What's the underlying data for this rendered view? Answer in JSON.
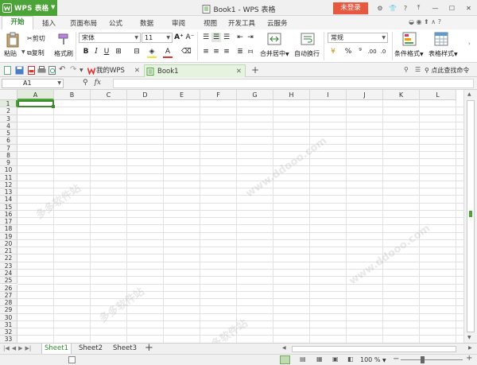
{
  "app": {
    "name": "WPS 表格",
    "window_title": "Book1 - WPS 表格",
    "login_label": "未登录"
  },
  "colors": {
    "brand_green": "#4ca438",
    "login_red": "#e8573f",
    "active_tab_text": "#2f8a2f"
  },
  "ribbon_tabs": [
    "开始",
    "插入",
    "页面布局",
    "公式",
    "数据",
    "审阅",
    "视图",
    "开发工具",
    "云服务"
  ],
  "active_ribbon_tab": "开始",
  "clipboard": {
    "paste": "粘贴",
    "cut": "剪切",
    "copy": "复制",
    "format_painter": "格式刷"
  },
  "font": {
    "name": "宋体",
    "size": "11"
  },
  "alignment": {
    "merge_center": "合并居中",
    "wrap_text": "自动换行"
  },
  "number": {
    "format": "常规"
  },
  "styles": {
    "conditional": "条件格式",
    "table_style": "表格样式"
  },
  "document_tabs": {
    "my_wps": "我的WPS",
    "book": "Book1"
  },
  "command_search": "点此查找命令",
  "formula_bar": {
    "cell_ref": "A1",
    "fx": "fx",
    "content": ""
  },
  "columns": [
    "A",
    "B",
    "C",
    "D",
    "E",
    "F",
    "G",
    "H",
    "I",
    "J",
    "K",
    "L"
  ],
  "rows": [
    "1",
    "2",
    "3",
    "4",
    "5",
    "6",
    "7",
    "8",
    "9",
    "10",
    "11",
    "12",
    "13",
    "14",
    "15",
    "16",
    "17",
    "18",
    "19",
    "20",
    "21",
    "22",
    "23",
    "24",
    "25",
    "26",
    "27",
    "28",
    "29",
    "30",
    "31",
    "32",
    "33"
  ],
  "sheets": [
    "Sheet1",
    "Sheet2",
    "Sheet3"
  ],
  "active_sheet": "Sheet1",
  "zoom": "100 %",
  "watermarks": [
    "多多软件站",
    "www.ddooo.com"
  ]
}
